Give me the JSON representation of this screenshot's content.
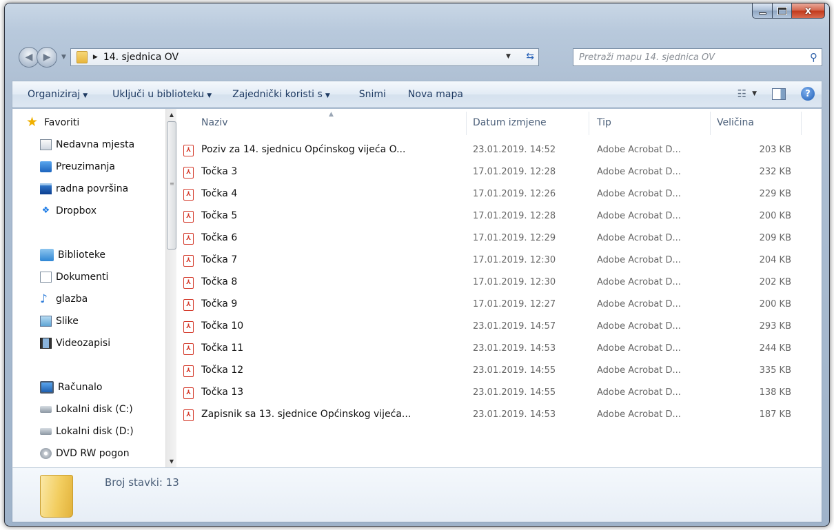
{
  "window": {
    "caption_buttons": {
      "minimize_icon": "minimize-icon",
      "maximize_icon": "maximize-icon",
      "close_glyph": "x"
    }
  },
  "address": {
    "path": "14. sjednica OV",
    "search_placeholder": "Pretraži mapu 14. sjednica OV"
  },
  "toolbar": {
    "organize": "Organiziraj",
    "include_in_library": "Uključi u biblioteku",
    "share_with": "Zajednički koristi s",
    "burn": "Snimi",
    "new_folder": "Nova mapa"
  },
  "sidebar": {
    "favorites_header": "Favoriti",
    "favorites": [
      {
        "label": "Nedavna mjesta",
        "icon": "recent-places-icon"
      },
      {
        "label": "Preuzimanja",
        "icon": "downloads-icon"
      },
      {
        "label": "radna površina",
        "icon": "desktop-icon"
      },
      {
        "label": "Dropbox",
        "icon": "dropbox-icon"
      }
    ],
    "libraries_header": "Biblioteke",
    "libraries": [
      {
        "label": "Dokumenti",
        "icon": "documents-icon"
      },
      {
        "label": "glazba",
        "icon": "music-icon"
      },
      {
        "label": "Slike",
        "icon": "pictures-icon"
      },
      {
        "label": "Videozapisi",
        "icon": "videos-icon"
      }
    ],
    "computer_header": "Računalo",
    "drives": [
      {
        "label": "Lokalni disk (C:)",
        "icon": "local-disk-c-icon"
      },
      {
        "label": "Lokalni disk (D:)",
        "icon": "local-disk-d-icon"
      },
      {
        "label": "DVD RW pogon",
        "icon": "dvd-drive-icon"
      }
    ]
  },
  "columns": {
    "name": "Naziv",
    "date": "Datum izmjene",
    "type": "Tip",
    "size": "Veličina"
  },
  "files": [
    {
      "name": "Poziv za 14. sjednicu Općinskog vijeća O...",
      "date": "23.01.2019. 14:52",
      "type": "Adobe Acrobat D...",
      "size": "203 KB"
    },
    {
      "name": "Točka 3",
      "date": "17.01.2019. 12:28",
      "type": "Adobe Acrobat D...",
      "size": "232 KB"
    },
    {
      "name": "Točka 4",
      "date": "17.01.2019. 12:26",
      "type": "Adobe Acrobat D...",
      "size": "229 KB"
    },
    {
      "name": "Točka 5",
      "date": "17.01.2019. 12:28",
      "type": "Adobe Acrobat D...",
      "size": "200 KB"
    },
    {
      "name": "Točka 6",
      "date": "17.01.2019. 12:29",
      "type": "Adobe Acrobat D...",
      "size": "209 KB"
    },
    {
      "name": "Točka 7",
      "date": "17.01.2019. 12:30",
      "type": "Adobe Acrobat D...",
      "size": "204 KB"
    },
    {
      "name": "Točka 8",
      "date": "17.01.2019. 12:30",
      "type": "Adobe Acrobat D...",
      "size": "202 KB"
    },
    {
      "name": "Točka 9",
      "date": "17.01.2019. 12:27",
      "type": "Adobe Acrobat D...",
      "size": "200 KB"
    },
    {
      "name": "Točka 10",
      "date": "23.01.2019. 14:57",
      "type": "Adobe Acrobat D...",
      "size": "293 KB"
    },
    {
      "name": "Točka 11",
      "date": "23.01.2019. 14:53",
      "type": "Adobe Acrobat D...",
      "size": "244 KB"
    },
    {
      "name": "Točka 12",
      "date": "23.01.2019. 14:55",
      "type": "Adobe Acrobat D...",
      "size": "335 KB"
    },
    {
      "name": "Točka 13",
      "date": "23.01.2019. 14:55",
      "type": "Adobe Acrobat D...",
      "size": "138 KB"
    },
    {
      "name": "Zapisnik sa 13. sjednice Općinskog vijeća...",
      "date": "23.01.2019. 14:53",
      "type": "Adobe Acrobat D...",
      "size": "187 KB"
    }
  ],
  "details": {
    "item_count": "Broj stavki: 13"
  },
  "colors": {
    "accent": "#1e3a62",
    "pdf_red": "#d43a2b",
    "frame": "#aebfd3"
  }
}
